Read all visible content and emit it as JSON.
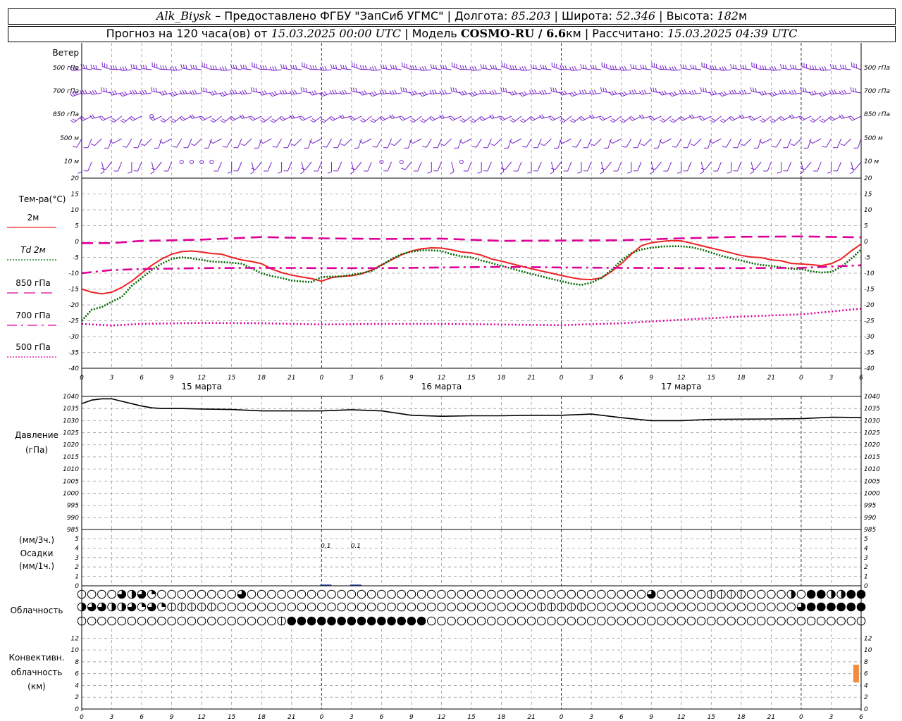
{
  "header": {
    "station": "Alk_Biysk",
    "provider": "Предоставлено ФГБУ \"ЗапСиб УГМС\"",
    "lon_label": "Долгота:",
    "lon": "85.203",
    "lat_label": "Широта:",
    "lat": "52.346",
    "alt_label": "Высота:",
    "alt": "182",
    "alt_unit": "м",
    "forecast_label": "Прогноз на 120 часа(ов) от",
    "forecast_start": "15.03.2025 00:00 UTC",
    "model_label": "Модель",
    "model": "COSMO-RU / 6.6",
    "model_unit": "км",
    "calc_label": "Рассчитано:",
    "calc_time": "15.03.2025 04:39 UTC"
  },
  "wind_panel": {
    "title": "Ветер",
    "levels": [
      "500 гПа",
      "700 гПа",
      "850 гПа",
      "500 м",
      "10 м"
    ]
  },
  "temp_panel": {
    "title": "Тем-ра(°C)",
    "legend": [
      {
        "label": "2м",
        "color": "#ee2222",
        "style": "solid"
      },
      {
        "label": "Td 2м",
        "color": "#006600",
        "style": "dotted"
      },
      {
        "label": "850 гПа",
        "color": "#dd0099",
        "style": "dashed"
      },
      {
        "label": "700 гПа",
        "color": "#dd0099",
        "style": "dashdot"
      },
      {
        "label": "500 гПа",
        "color": "#dd0099",
        "style": "dotted"
      }
    ],
    "y_ticks": [
      "20",
      "15",
      "10",
      "5",
      "0",
      "-5",
      "-10",
      "-15",
      "-20",
      "-25",
      "-30",
      "-35",
      "-40"
    ]
  },
  "time_axis": {
    "hour_labels": [
      "0",
      "3",
      "6",
      "9",
      "12",
      "15",
      "18",
      "21",
      "0",
      "3",
      "6",
      "9",
      "12",
      "15",
      "18",
      "21",
      "0",
      "3",
      "6",
      "9",
      "12",
      "15",
      "18",
      "21",
      "0",
      "3",
      "6"
    ],
    "day_labels": [
      "15 марта",
      "16 марта",
      "17 марта"
    ]
  },
  "pressure_panel": {
    "title_line1": "Давление",
    "title_line2": "(гПа)",
    "y_ticks": [
      "1040",
      "1035",
      "1030",
      "1025",
      "1020",
      "1015",
      "1010",
      "1005",
      "1000",
      "995",
      "990",
      "985"
    ]
  },
  "precip_panel": {
    "title_line1": "(мм/3ч.)",
    "title_line2": "Осадки",
    "title_line3": "(мм/1ч.)",
    "y_ticks": [
      "5",
      "4",
      "3",
      "2",
      "1",
      "0"
    ],
    "annotations": [
      {
        "hour": 24,
        "text": "0.1"
      },
      {
        "hour": 27,
        "text": "0.1"
      }
    ]
  },
  "cloud_panel": {
    "title": "Облачность"
  },
  "conv_panel": {
    "title_line1": "Конвективн.",
    "title_line2": "облачность",
    "title_line3": "(км)",
    "y_ticks": [
      "12",
      "10",
      "8",
      "6",
      "4",
      "2",
      "0"
    ],
    "bar_color": "#f08c3c"
  },
  "chart_data": [
    {
      "type": "line",
      "title": "Тем-ра(°C)",
      "x_unit": "hours since 15.03.2025 00:00 UTC",
      "ylim": [
        -40,
        20
      ],
      "grid": true,
      "series": [
        {
          "name": "2м",
          "x": [
            0,
            1,
            2,
            3,
            4,
            5,
            6,
            7,
            8,
            9,
            10,
            11,
            12,
            13,
            14,
            15,
            16,
            17,
            18,
            19,
            20,
            21,
            22,
            23,
            24,
            25,
            26,
            27,
            28,
            29,
            30,
            31,
            32,
            33,
            34,
            35,
            36,
            37,
            38,
            39,
            40,
            41,
            42,
            43,
            44,
            45,
            46,
            47,
            48,
            49,
            50,
            51,
            52,
            53,
            54,
            55,
            56,
            57,
            58,
            59,
            60,
            61,
            62,
            63,
            64,
            65,
            66,
            67,
            68,
            69,
            70,
            71,
            72,
            73,
            74,
            75,
            76,
            77,
            78
          ],
          "values": [
            -15,
            -16,
            -16.5,
            -16,
            -14.5,
            -12.5,
            -10,
            -7.5,
            -5.5,
            -4,
            -3.2,
            -3,
            -3.3,
            -3.8,
            -4,
            -5,
            -5.8,
            -6.3,
            -7,
            -8.7,
            -9.8,
            -10.6,
            -11.2,
            -11.7,
            -12.5,
            -11.4,
            -11,
            -10.8,
            -10.2,
            -9,
            -7.4,
            -5.8,
            -4.2,
            -3,
            -2.3,
            -2,
            -2.1,
            -2.6,
            -3.3,
            -3.6,
            -4.3,
            -5.5,
            -6.2,
            -7,
            -7.8,
            -8.6,
            -9.3,
            -10,
            -10.7,
            -11.4,
            -11.9,
            -12,
            -11.5,
            -9.5,
            -7,
            -4,
            -1.3,
            -0.4,
            0,
            0.3,
            0.2,
            -0.5,
            -1.3,
            -2.1,
            -2.8,
            -3.6,
            -4.4,
            -4.9,
            -5.1,
            -5.8,
            -6.1,
            -6.9,
            -7.1,
            -7.3,
            -7.6,
            -7,
            -5.5,
            -3,
            -0.8
          ]
        },
        {
          "name": "Td 2м",
          "x": [
            0,
            1,
            2,
            3,
            4,
            5,
            6,
            7,
            8,
            9,
            10,
            11,
            12,
            13,
            14,
            15,
            16,
            17,
            18,
            19,
            20,
            21,
            22,
            23,
            24,
            25,
            26,
            27,
            28,
            29,
            30,
            31,
            32,
            33,
            34,
            35,
            36,
            37,
            38,
            39,
            40,
            41,
            42,
            43,
            44,
            45,
            46,
            47,
            48,
            49,
            50,
            51,
            52,
            53,
            54,
            55,
            56,
            57,
            58,
            59,
            60,
            61,
            62,
            63,
            64,
            65,
            66,
            67,
            68,
            69,
            70,
            71,
            72,
            73,
            74,
            75,
            76,
            77,
            78
          ],
          "values": [
            -25,
            -21.5,
            -20.7,
            -19,
            -17.5,
            -14,
            -11.5,
            -9,
            -7,
            -5.5,
            -5,
            -5.3,
            -5.8,
            -6.3,
            -6.5,
            -6.7,
            -7,
            -8.5,
            -10,
            -10.9,
            -11.5,
            -12.3,
            -12.6,
            -12.8,
            -11.2,
            -11.1,
            -11,
            -10.5,
            -10,
            -9.3,
            -7.5,
            -5.5,
            -4,
            -3.2,
            -2.8,
            -2.8,
            -3,
            -4,
            -4.7,
            -5,
            -6,
            -6.8,
            -7.7,
            -8.5,
            -9.4,
            -10.2,
            -11,
            -11.8,
            -12.5,
            -13.3,
            -13.7,
            -13,
            -11.5,
            -9,
            -6,
            -3.7,
            -2.5,
            -2,
            -1.6,
            -1.5,
            -1.5,
            -1.8,
            -2.5,
            -3.5,
            -4.5,
            -5.3,
            -6,
            -6.8,
            -7.4,
            -7.7,
            -8.2,
            -8.6,
            -8.7,
            -9.4,
            -9.8,
            -9.6,
            -8,
            -5.5,
            -2.5
          ]
        },
        {
          "name": "850 гПа",
          "x": [
            0,
            3,
            6,
            12,
            18,
            24,
            30,
            36,
            42,
            48,
            54,
            60,
            66,
            72,
            78
          ],
          "values": [
            -0.5,
            -0.5,
            0.2,
            0.6,
            1.4,
            1.0,
            0.8,
            0.9,
            0.2,
            0.3,
            0.4,
            1.0,
            1.5,
            1.6,
            1.3
          ]
        },
        {
          "name": "700 гПа",
          "x": [
            0,
            3,
            6,
            12,
            18,
            24,
            30,
            36,
            42,
            48,
            54,
            60,
            66,
            72,
            78
          ],
          "values": [
            -10,
            -9,
            -8.7,
            -8.4,
            -8.3,
            -8.4,
            -8.4,
            -8.2,
            -8,
            -8.2,
            -8.3,
            -8.4,
            -8.4,
            -8.3,
            -7.5
          ]
        },
        {
          "name": "500 гПа",
          "x": [
            0,
            3,
            6,
            12,
            18,
            24,
            30,
            36,
            42,
            48,
            54,
            60,
            66,
            72,
            78
          ],
          "values": [
            -26,
            -26.5,
            -26,
            -25.7,
            -25.8,
            -26.2,
            -26,
            -26,
            -26.2,
            -26.4,
            -25.8,
            -24.7,
            -23.7,
            -23,
            -21.2
          ]
        }
      ]
    },
    {
      "type": "line",
      "title": "Давление",
      "ylabel": "(гПа)",
      "x_unit": "hours since 15.03.2025 00:00 UTC",
      "ylim": [
        985,
        1040
      ],
      "series": [
        {
          "name": "Давление",
          "x": [
            0,
            1,
            2,
            3,
            4,
            5,
            6,
            7,
            8,
            9,
            10,
            12,
            15,
            18,
            21,
            24,
            27,
            30,
            33,
            36,
            39,
            42,
            45,
            48,
            51,
            54,
            57,
            60,
            63,
            66,
            69,
            72,
            75,
            78
          ],
          "values": [
            1037,
            1038.5,
            1039,
            1039,
            1038,
            1037,
            1036,
            1035.3,
            1035,
            1035,
            1035,
            1034.8,
            1034.6,
            1034,
            1034,
            1034,
            1034.5,
            1034,
            1032.2,
            1031.8,
            1032,
            1032,
            1032.2,
            1032.2,
            1032.7,
            1031.2,
            1030,
            1030,
            1030.5,
            1030.6,
            1030.7,
            1030.8,
            1031.4,
            1031.3
          ]
        }
      ]
    },
    {
      "type": "bar",
      "title": "Осадки",
      "ylim": [
        0,
        5
      ],
      "x_hours": [
        24,
        27
      ],
      "values": [
        0.1,
        0.1
      ]
    },
    {
      "type": "bar",
      "title": "Конвективн. облачность (км)",
      "ylim": [
        0,
        13
      ],
      "bars": [
        {
          "x_hours": 77.5,
          "bottom": 4.5,
          "top": 7.5
        }
      ]
    }
  ]
}
